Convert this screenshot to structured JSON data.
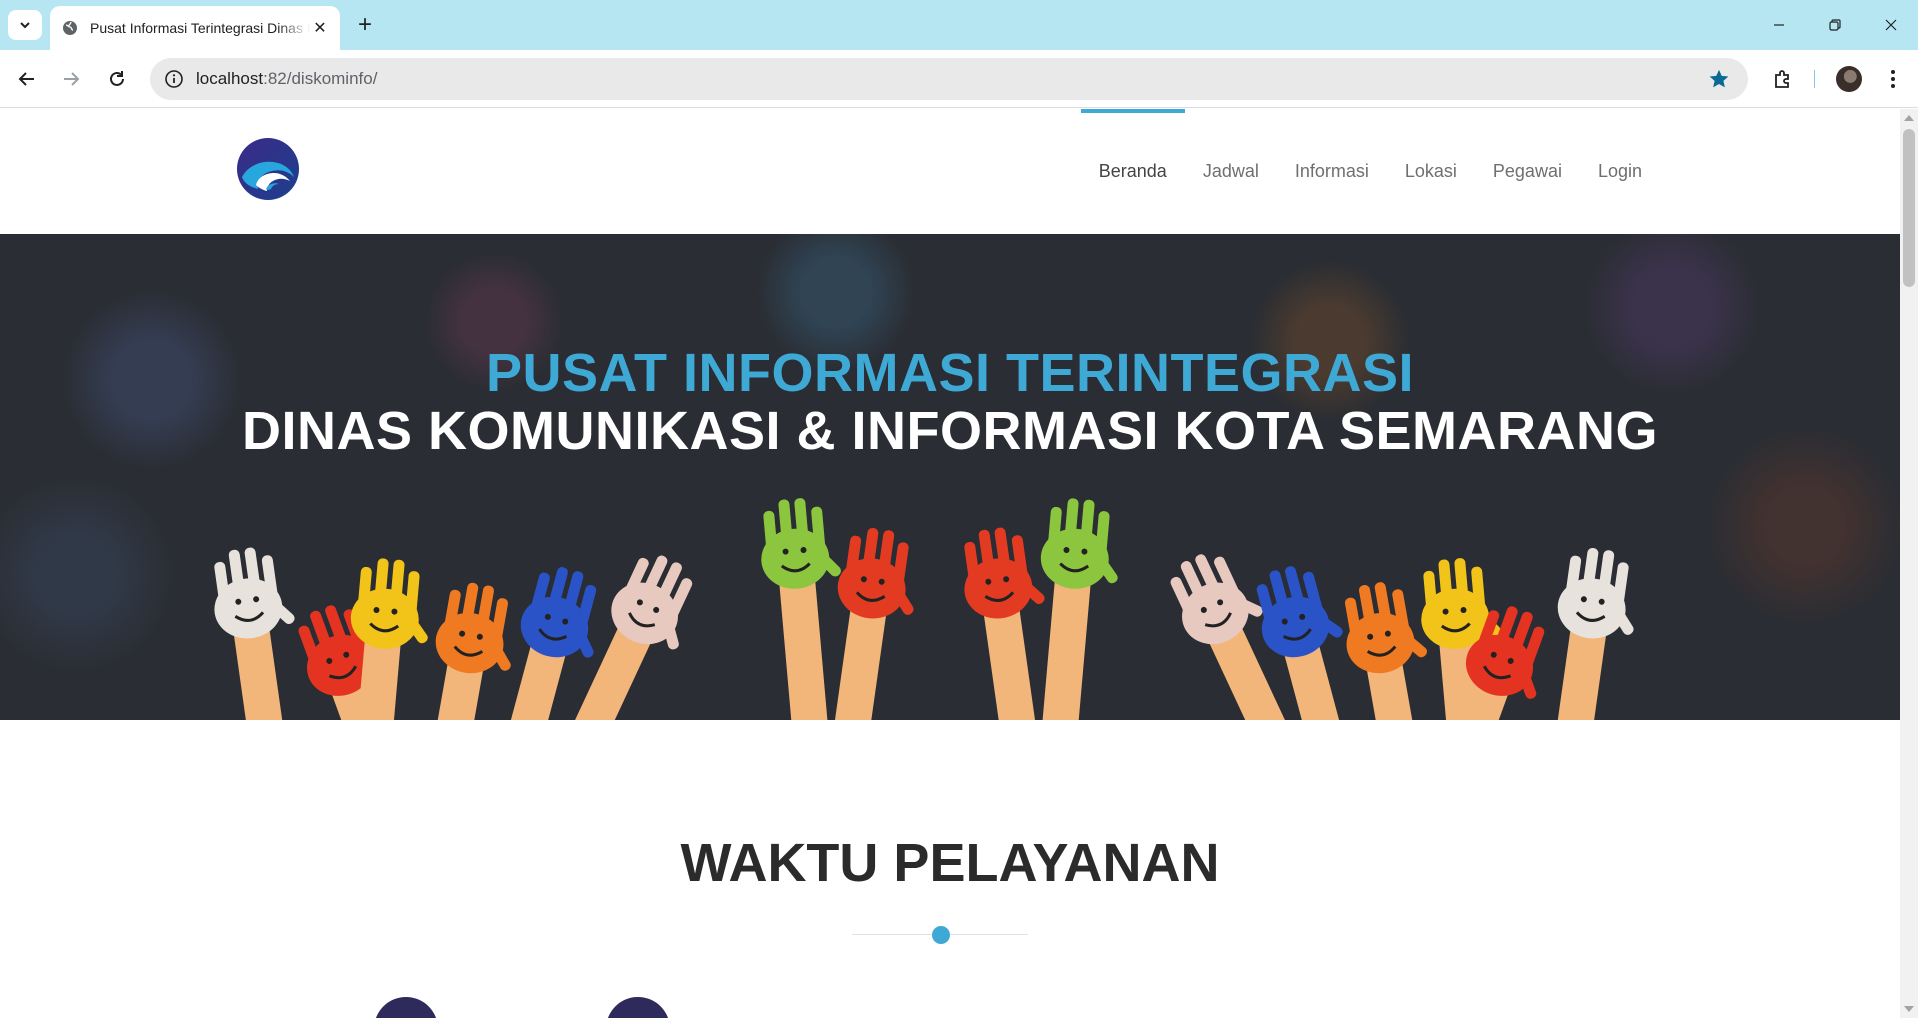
{
  "browser": {
    "tab_title": "Pusat Informasi Terintegrasi Dinas Komunikasi & Informasi Kota Semarang",
    "tab_close": "✕",
    "new_tab": "+",
    "url_host": "localhost",
    "url_path": ":82/diskominfo/"
  },
  "site": {
    "nav": [
      {
        "label": "Beranda",
        "active": true
      },
      {
        "label": "Jadwal"
      },
      {
        "label": "Informasi"
      },
      {
        "label": "Lokasi"
      },
      {
        "label": "Pegawai"
      },
      {
        "label": "Login"
      }
    ]
  },
  "hero": {
    "line1": "PUSAT INFORMASI TERINTEGRASI",
    "line2": "DINAS KOMUNIKASI & INFORMASI KOTA SEMARANG"
  },
  "section": {
    "title": "WAKTU PELAYANAN"
  },
  "colors": {
    "accent": "#3fa9d6",
    "tabbar": "#b6e6f2",
    "hero_bg": "#2a2d33",
    "icon_purple": "#2e2a5c"
  }
}
